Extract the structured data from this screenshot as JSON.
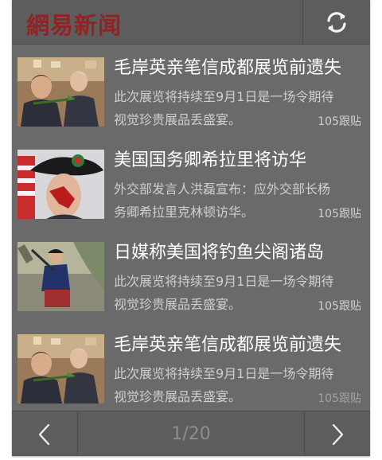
{
  "app": {
    "logo_text": "網易新闻",
    "logo_color": "#8f2424"
  },
  "toolbar": {
    "refresh_icon": "refresh-icon"
  },
  "news": [
    {
      "title": "毛岸英亲笔信成都展览前遗失",
      "summary_line1": "此次展览将持续至9月1日是一场令期待",
      "summary_line2": "视觉珍贵展品丢盛宴。",
      "replies": "105跟贴"
    },
    {
      "title": "美国国务卿希拉里将访华",
      "summary_line1": "外交部发言人洪磊宣布：应外交部长杨",
      "summary_line2": "务卿希拉里克林顿访华。",
      "replies": "105跟贴"
    },
    {
      "title": "日媒称美国将钓鱼尖阁诸岛",
      "summary_line1": "此次展览将持续至9月1日是一场令期待",
      "summary_line2": "视觉珍贵展品丢盛宴。",
      "replies": "105跟贴"
    },
    {
      "title": "毛岸英亲笔信成都展览前遗失",
      "summary_line1": "此次展览将持续至9月1日是一场令期待",
      "summary_line2": "视觉珍贵展品丢盛宴。",
      "replies": "105跟贴"
    }
  ],
  "pagination": {
    "label": "1/20",
    "prev_icon": "chevron-left-icon",
    "next_icon": "chevron-right-icon"
  }
}
